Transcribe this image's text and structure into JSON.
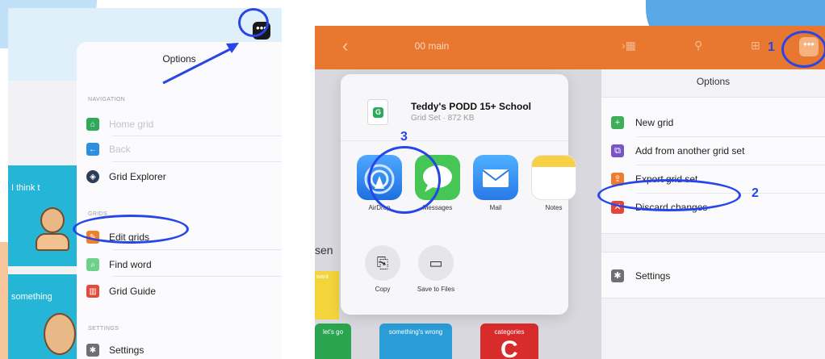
{
  "left": {
    "options_title": "Options",
    "tile_think": "I think t",
    "tile_something": "something",
    "sections": {
      "navigation": "NAVIGATION",
      "grids": "GRIDS",
      "settings": "SETTINGS"
    },
    "items": [
      {
        "label": "Home grid",
        "icon": "home-icon",
        "color": "#2eaa5a",
        "dim": true
      },
      {
        "label": "Back",
        "icon": "back-arrow-icon",
        "color": "#2e8fe0",
        "dim": true
      },
      {
        "label": "Grid Explorer",
        "icon": "compass-icon",
        "color": "#2c3d5a",
        "dim": false
      },
      {
        "label": "Edit grids",
        "icon": "pencil-icon",
        "color": "#f07f2b",
        "dim": false
      },
      {
        "label": "Find word",
        "icon": "magnifier-icon",
        "color": "#6fcf8d",
        "dim": false
      },
      {
        "label": "Grid Guide",
        "icon": "book-icon",
        "color": "#e24b3b",
        "dim": false
      },
      {
        "label": "Settings",
        "icon": "gear-icon",
        "color": "#6e6e73",
        "dim": false
      }
    ]
  },
  "right": {
    "topbar_title": "00 main",
    "sen_text": "sen",
    "tiles": {
      "want": "want",
      "lets_go": "let's go",
      "something_wrong": "something's wrong",
      "categories": "categories",
      "categories_letter": "C"
    },
    "share": {
      "file_name": "Teddy's PODD 15+ School",
      "file_sub": "Grid Set · 872 KB",
      "file_icon_letter": "G",
      "apps": [
        "AirDrop",
        "Messages",
        "Mail",
        "Notes"
      ],
      "actions": [
        "Copy",
        "Save to Files"
      ]
    },
    "options_title": "Options",
    "options_items": [
      {
        "label": "New grid",
        "icon": "plus-icon",
        "color": "#3fae5b"
      },
      {
        "label": "Add from another grid set",
        "icon": "import-icon",
        "color": "#7a55c8"
      },
      {
        "label": "Export grid set",
        "icon": "export-icon",
        "color": "#ef7c2c"
      },
      {
        "label": "Discard changes",
        "icon": "close-icon",
        "color": "#e2473a"
      }
    ],
    "settings_label": "Settings"
  },
  "callouts": [
    "1",
    "2",
    "3"
  ],
  "colors": {
    "annotation": "#2746e8",
    "topbar": "#e8782f"
  }
}
